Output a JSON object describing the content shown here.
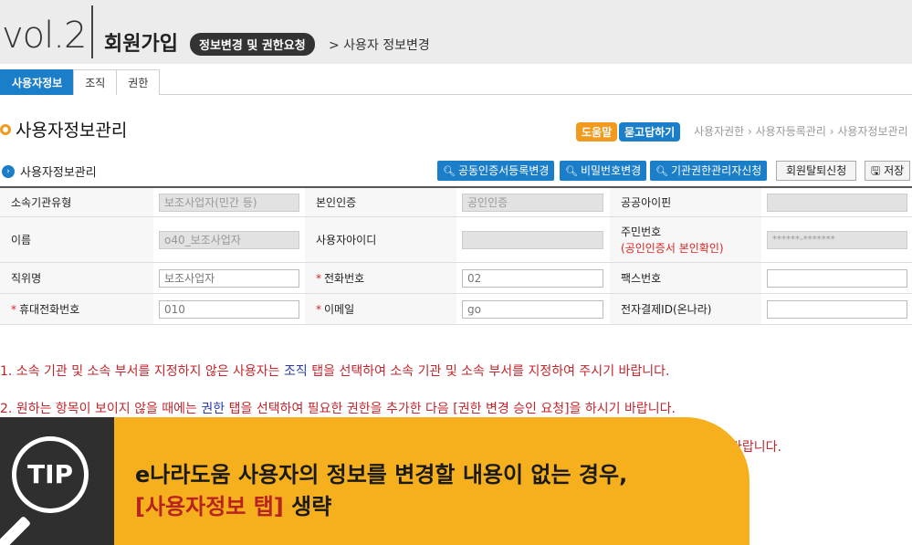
{
  "header": {
    "vol": "vol.2",
    "title": "회원가입",
    "pill": "정보변경 및 권한요청",
    "crumb": "> 사용자 정보변경"
  },
  "tabs": [
    {
      "label": "사용자정보",
      "active": true
    },
    {
      "label": "조직",
      "active": false
    },
    {
      "label": "권한",
      "active": false
    }
  ],
  "section": {
    "title": "사용자정보관리",
    "help": "도움말",
    "qa": "묻고답하기",
    "breadcrumb": "사용자권한 › 사용자등록관리 › 사용자정보관리"
  },
  "subsection": {
    "title": "사용자정보관리",
    "btn_cert": "공동인증서등록변경",
    "btn_pw": "비밀번호변경",
    "btn_auth": "기관권한관리자신청",
    "btn_withdraw": "회원탈퇴신청",
    "btn_save": "저장"
  },
  "form": {
    "org_type_label": "소속기관유형",
    "org_type_value": "보조사업자(민간 등)",
    "identity_label": "본인인증",
    "identity_value": "공인인증",
    "ipin_label": "공공아이핀",
    "name_label": "이름",
    "name_value": "o40_보조사업자",
    "userid_label": "사용자아이디",
    "rrn_label": "주민번호",
    "rrn_note": "(공인인증서 본인확인)",
    "rrn_value": "******-*******",
    "position_label": "직위명",
    "position_value": "보조사업자",
    "phone_label": "전화번호",
    "phone_value": "02",
    "fax_label": "팩스번호",
    "mobile_label": "휴대전화번호",
    "mobile_value": "010",
    "email_label": "이메일",
    "email_value": "go",
    "epay_label": "전자결제ID(온나라)",
    "required_mark": "*"
  },
  "notes": {
    "n1_a": "1. 소속 기관 및 소속 부서를 지정하지 않은 사용자는 ",
    "n1_hl": "조직",
    "n1_b": " 탭을 선택하여 소속 기관 및 소속 부서를 지정하여 주시기 바랍니다.",
    "n2_a": "2. 원하는 항목이 보이지 않을 때에는 ",
    "n2_hl": "권한",
    "n2_b": " 탭을 선택하여 필요한 권한을 추가한 다음 [권한 변경 승인 요청]을 하시기 바랍니다.",
    "n3_tail": "바랍니다."
  },
  "tip": {
    "badge": "TIP",
    "line1": "e나라도움 사용자의 정보를 변경할 내용이 없는 경우,",
    "line2_em": "[사용자정보 탭]",
    "line2_rest": " 생략"
  }
}
